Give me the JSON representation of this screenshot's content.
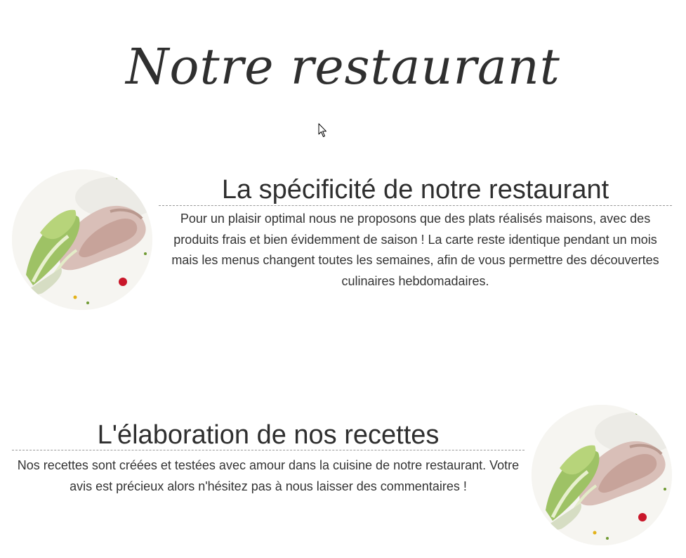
{
  "page": {
    "title": "Notre restaurant"
  },
  "sections": [
    {
      "heading": "La spécificité de notre restaurant",
      "text": "Pour un plaisir optimal nous ne proposons que des plats réalisés maisons, avec des produits frais et bien évidemment de saison ! La carte reste identique pendant un mois mais les menus changent toutes les semaines, afin de vous permettre des découvertes culinaires hebdomadaires.",
      "image_position": "left"
    },
    {
      "heading": "L'élaboration de nos recettes",
      "text": "Nos recettes sont créées et testées avec amour dans la cuisine de notre restaurant. Votre avis est précieux alors n'hésitez pas à nous laisser des commentaires !",
      "image_position": "right"
    }
  ],
  "icons": {
    "cursor": "mouse-pointer-icon"
  },
  "colors": {
    "text": "#333333",
    "divider": "#999999",
    "background": "#ffffff"
  }
}
